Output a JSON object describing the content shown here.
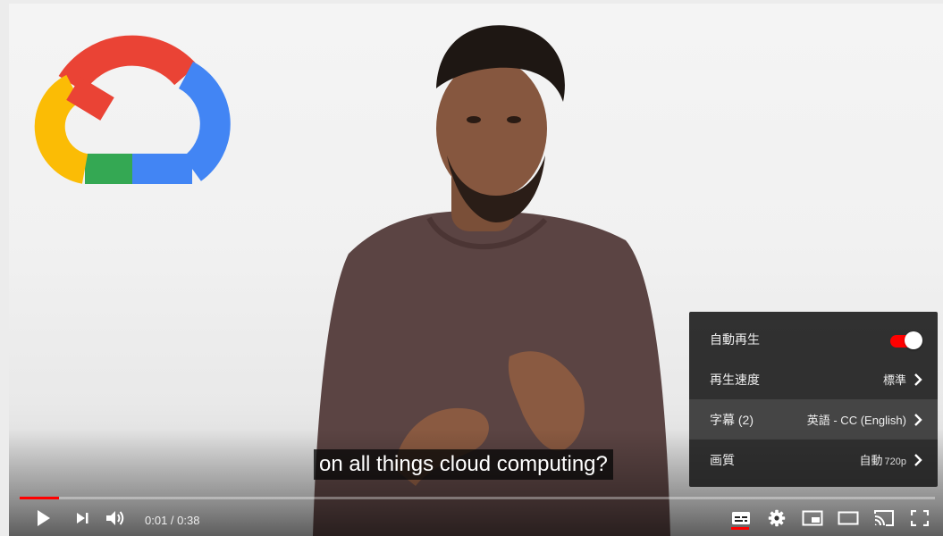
{
  "caption": {
    "text": "on all things cloud computing?"
  },
  "settings": {
    "items": [
      {
        "label": "自動再生",
        "type": "toggle",
        "on": true
      },
      {
        "label": "再生速度",
        "value": "標準"
      },
      {
        "label": "字幕 (2)",
        "value": "英語 - CC (English)"
      },
      {
        "label": "画質",
        "value": "自動",
        "value_small": "720p"
      }
    ]
  },
  "progress": {
    "played_fraction": 0.043,
    "loaded_fraction": 0.043
  },
  "time": {
    "display": "0:01 / 0:38"
  },
  "controls": [
    "play-icon",
    "next-icon",
    "volume-icon",
    "subtitles-icon",
    "settings-icon",
    "miniplayer-icon",
    "theater-icon",
    "cast-icon",
    "fullscreen-icon"
  ],
  "colors": {
    "accent": "#ff0000",
    "menu_bg": "#1c1c1c",
    "gc_red": "#ea4335",
    "gc_blue": "#4285f4",
    "gc_yellow": "#fbbc05",
    "gc_green": "#34a853"
  }
}
